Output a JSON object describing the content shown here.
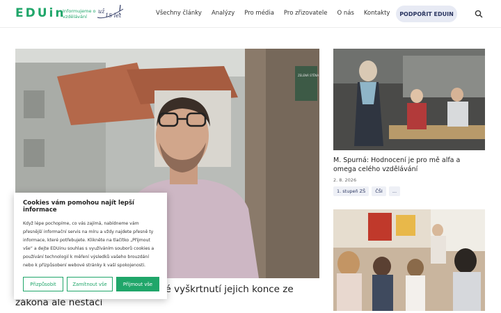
{
  "header": {
    "logo_text": "EDUin",
    "logo_sub": "Informujeme o vzdělávání",
    "anniv_text": "už 15 let!",
    "nav": [
      "Všechny články",
      "Analýzy",
      "Pro média",
      "Pro zřizovatele",
      "O nás",
      "Kontakty"
    ],
    "support_label": "PODPOŘIT EDUIN",
    "search_icon": "search-icon"
  },
  "hero": {
    "title_visible": "né vyškrtnutí jejich konce ze zákona ale nestačí",
    "title_line1": "né vyškrtnutí jejich konce ze",
    "title_line2": "zákona ale nestačí",
    "sign_text": "ZELENÁ STĚNA"
  },
  "side": {
    "card1": {
      "title": "M. Spurná: Hodnocení je pro mě alfa a omega celého vzdělávání",
      "date": "2. 8. 2026",
      "tags": [
        "1. stupeň ZŠ",
        "ČŠI",
        "..."
      ]
    }
  },
  "cookie": {
    "title": "Cookies vám pomohou najít lepší informace",
    "text": "Když lépe pochopíme, co vás zajímá, nabídneme vám přesnější informační servis na míru a vždy najdete přesně ty informace, které potřebujete. Klikněte na tlačítko „Přijmout vše“ a dejte EDUinu souhlas s využíváním souborů cookies a používání technologií k měření výsledků vašeho brouzdání nebo k přizpůsobení webové stránky k vaší spokojenosti.",
    "buttons": [
      "Přizpůsobit",
      "Zamítnout vše",
      "Přijmout vše"
    ]
  },
  "colors": {
    "brand_green": "#20a66a",
    "support_bg": "#e7eaf4",
    "tag_bg": "#eef0f6"
  }
}
